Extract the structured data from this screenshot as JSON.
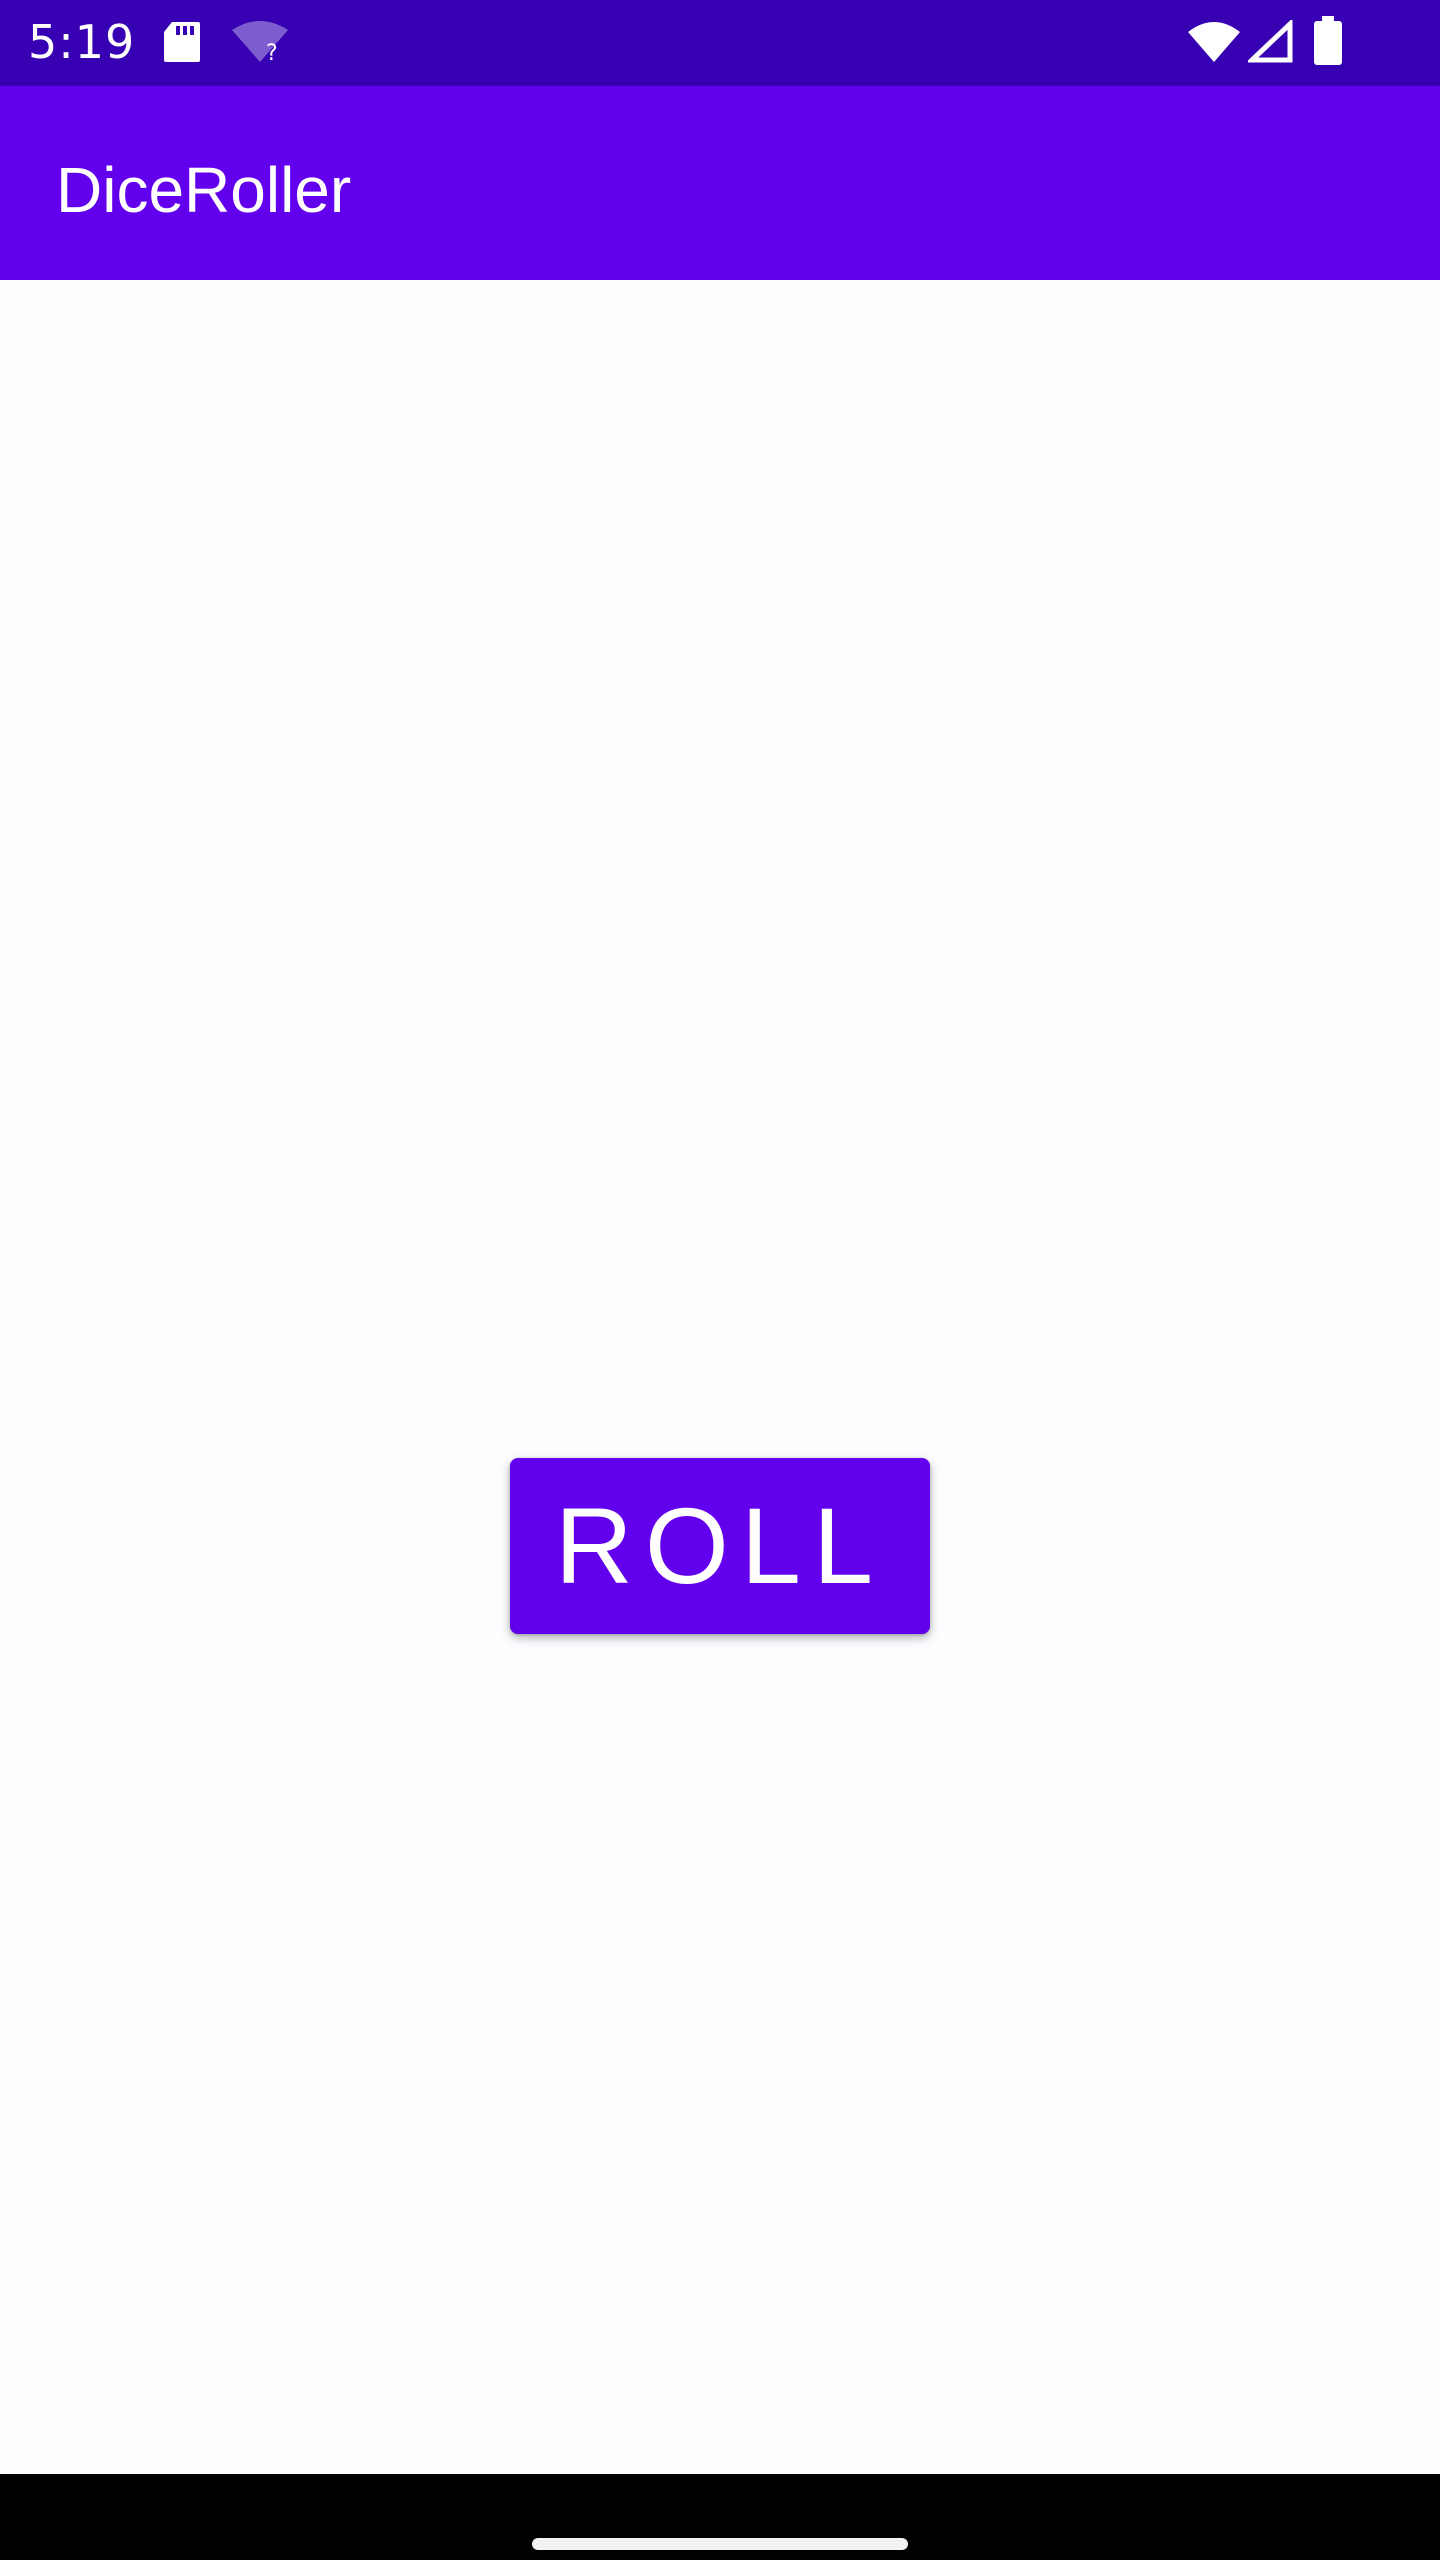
{
  "status_bar": {
    "time": "5:19",
    "icons": [
      "sd-card-icon",
      "wifi-unknown-icon",
      "wifi-icon",
      "signal-icon",
      "battery-icon"
    ]
  },
  "app_bar": {
    "title": "DiceRoller"
  },
  "main": {
    "roll_button_label": "ROLL"
  },
  "colors": {
    "status_bar": "#3700b3",
    "primary": "#6200ee",
    "background": "#fdfcff",
    "nav_bar": "#000000",
    "on_primary": "#ffffff"
  }
}
